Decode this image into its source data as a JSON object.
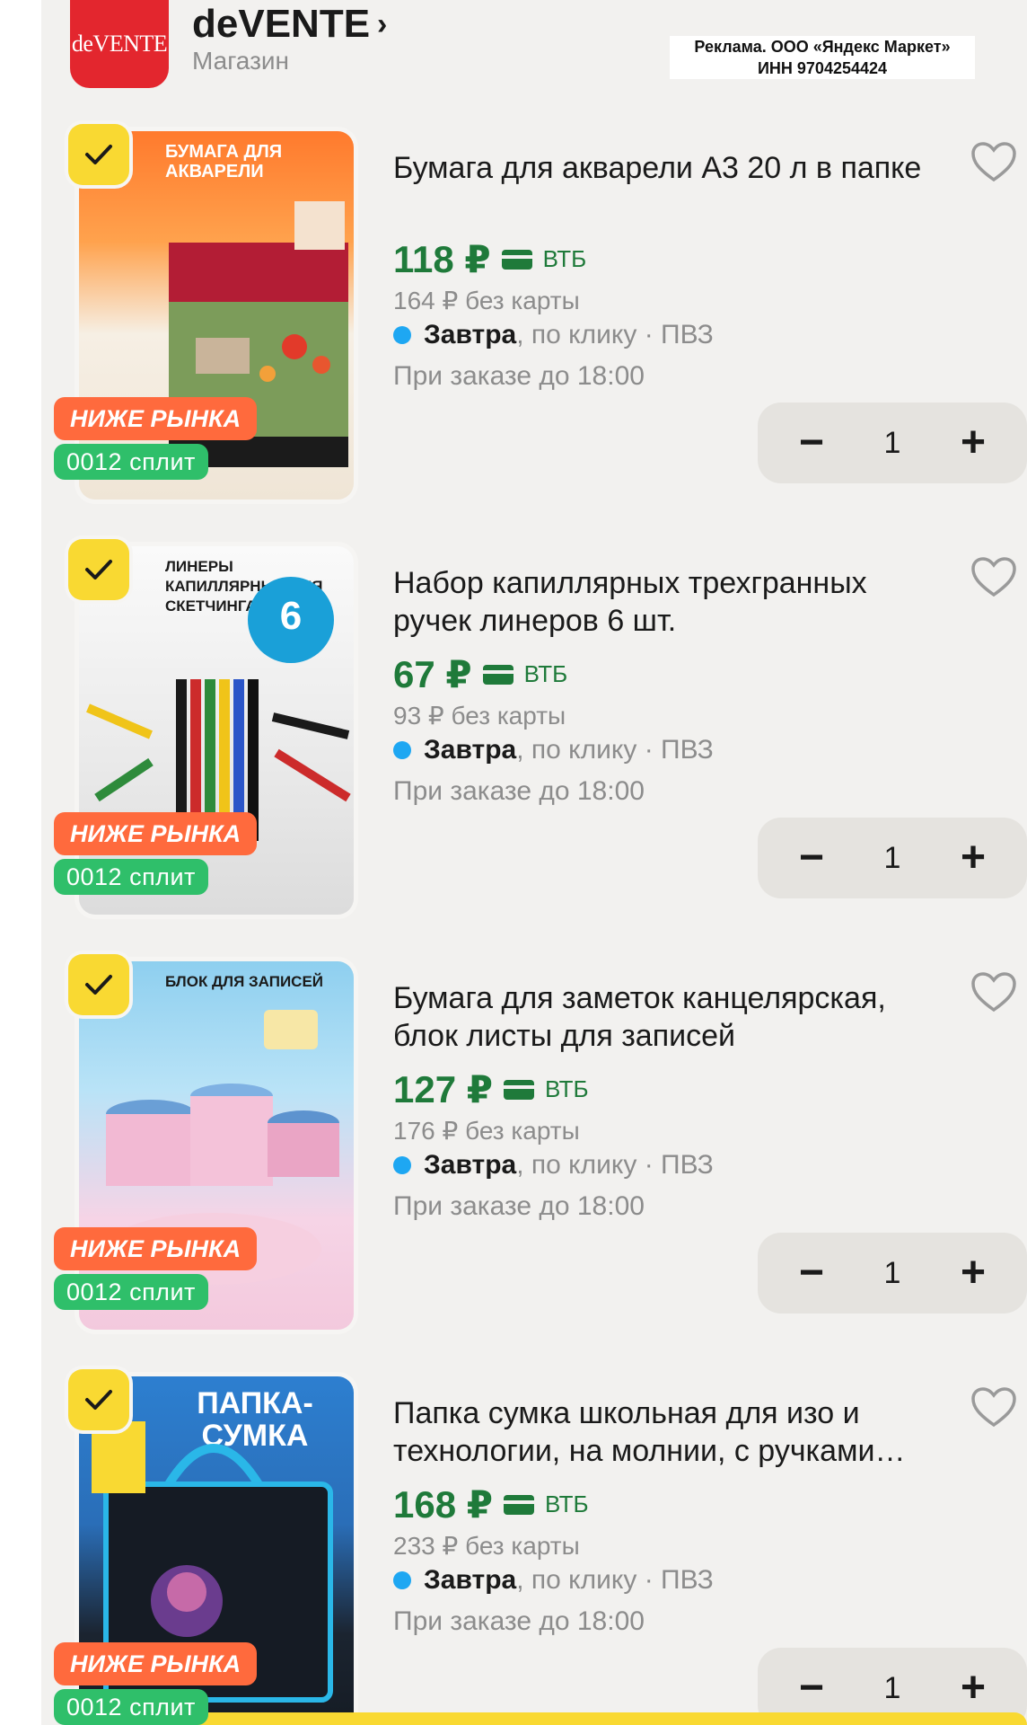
{
  "header": {
    "logo_text": "deVENTE",
    "shop_name": "deVENTE",
    "shop_chevron": "›",
    "shop_subtitle": "Магазин",
    "ad_line1": "Реклама. ООО «Яндекс Маркет»",
    "ad_line2": "ИНН 9704254424"
  },
  "colors": {
    "price_green": "#1f7a3a",
    "check_badge": "#f9d932",
    "market_badge": "#ff6a3d",
    "split_badge": "#2fbf6a",
    "delivery_dot": "#1ea7f2"
  },
  "products": [
    {
      "thumb_text": "БУМАГА ДЛЯ АКВАРЕЛИ",
      "badge_market": "НИЖЕ РЫНКА",
      "badge_split": "0012 сплит",
      "title": "Бумага для акварели А3 20 л в папке",
      "price": "118 ₽",
      "bank": "ВТБ",
      "old_price": "164 ₽  без карты",
      "delivery_day": "Завтра",
      "delivery_rest": ", по клику · ПВЗ",
      "order_by": "При заказе до 18:00",
      "qty": "1",
      "minus": "−",
      "plus": "+"
    },
    {
      "thumb_text": "ЛИНЕРЫ КАПИЛЛЯРНЫЕ ДЛЯ СКЕТЧИНГА",
      "badge_market": "НИЖЕ РЫНКА",
      "badge_split": "0012 сплит",
      "title": "Набор капиллярных трехгранных ручек линеров 6 шт.",
      "price": "67 ₽",
      "bank": "ВТБ",
      "old_price": "93 ₽  без карты",
      "delivery_day": "Завтра",
      "delivery_rest": ", по клику · ПВЗ",
      "order_by": "При заказе до 18:00",
      "qty": "1",
      "minus": "−",
      "plus": "+"
    },
    {
      "thumb_text": "БЛОК ДЛЯ ЗАПИСЕЙ",
      "badge_market": "НИЖЕ РЫНКА",
      "badge_split": "0012 сплит",
      "title": "Бумага для заметок канцелярская, блок листы для записей",
      "price": "127 ₽",
      "bank": "ВТБ",
      "old_price": "176 ₽  без карты",
      "delivery_day": "Завтра",
      "delivery_rest": ", по клику · ПВЗ",
      "order_by": "При заказе до 18:00",
      "qty": "1",
      "minus": "−",
      "plus": "+"
    },
    {
      "thumb_text": "ПАПКА-СУМКА",
      "badge_market": "НИЖЕ РЫНКА",
      "badge_split": "0012 сплит",
      "title": "Папка сумка школьная для изо и технологии, на молнии, с ручками…",
      "price": "168 ₽",
      "bank": "ВТБ",
      "old_price": "233 ₽  без карты",
      "delivery_day": "Завтра",
      "delivery_rest": ", по клику · ПВЗ",
      "order_by": "При заказе до 18:00",
      "qty": "1",
      "minus": "−",
      "plus": "+"
    }
  ]
}
